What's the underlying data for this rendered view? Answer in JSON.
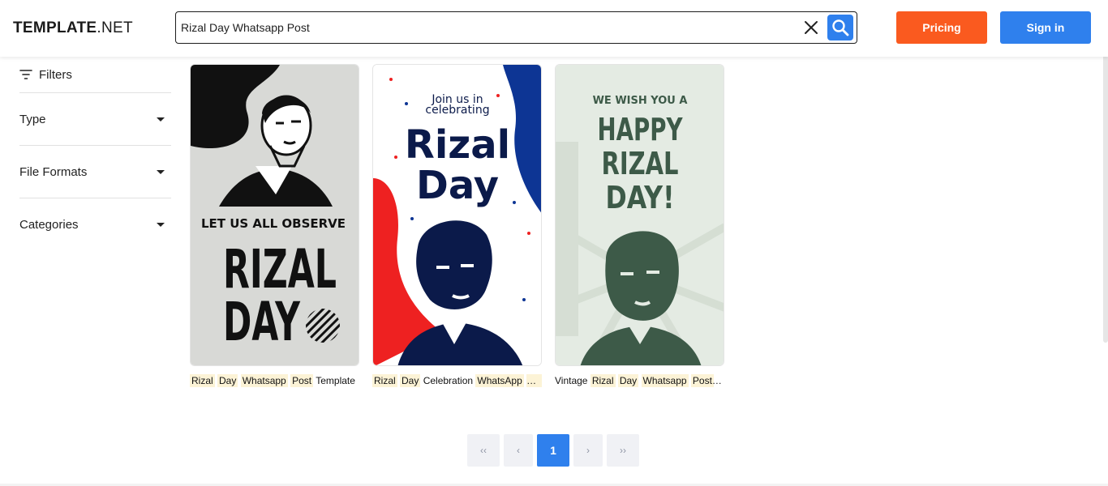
{
  "header": {
    "logo_bold": "TEMPLATE",
    "logo_dot": ".NET",
    "search_value": "Rizal Day Whatsapp Post",
    "pricing_label": "Pricing",
    "signin_label": "Sign in"
  },
  "sidebar": {
    "filters_label": "Filters",
    "facets": [
      "Type",
      "File Formats",
      "Categories"
    ]
  },
  "cards": [
    {
      "poster_lines": [
        "LET US ALL OBSERVE",
        "RIZAL",
        "DAY"
      ],
      "caption_parts": [
        [
          "Rizal",
          true
        ],
        [
          "Day",
          true
        ],
        [
          "Whatsapp",
          true
        ],
        [
          "Post",
          true
        ],
        [
          "Template",
          false
        ]
      ]
    },
    {
      "poster_lines": [
        "Join us in",
        "celebrating",
        "Rizal",
        "Day"
      ],
      "caption_parts": [
        [
          "Rizal",
          true
        ],
        [
          "Day",
          true
        ],
        [
          "Celebration",
          false
        ],
        [
          "WhatsApp",
          true
        ],
        [
          "P...",
          true
        ]
      ]
    },
    {
      "poster_lines": [
        "WE WISH YOU A",
        "HAPPY",
        "RIZAL",
        "DAY!"
      ],
      "caption_parts": [
        [
          "Vintage",
          false
        ],
        [
          "Rizal",
          true
        ],
        [
          "Day",
          true
        ],
        [
          "Whatsapp",
          true
        ],
        [
          "Post",
          true
        ],
        [
          "...",
          false
        ]
      ]
    }
  ],
  "pagination": {
    "first": "‹‹",
    "prev": "‹",
    "current": "1",
    "next": "›",
    "last": "››"
  },
  "colors": {
    "accent_blue": "#2f80ed",
    "pricing_orange": "#fa5a1f",
    "highlight": "#fcf3d6"
  }
}
